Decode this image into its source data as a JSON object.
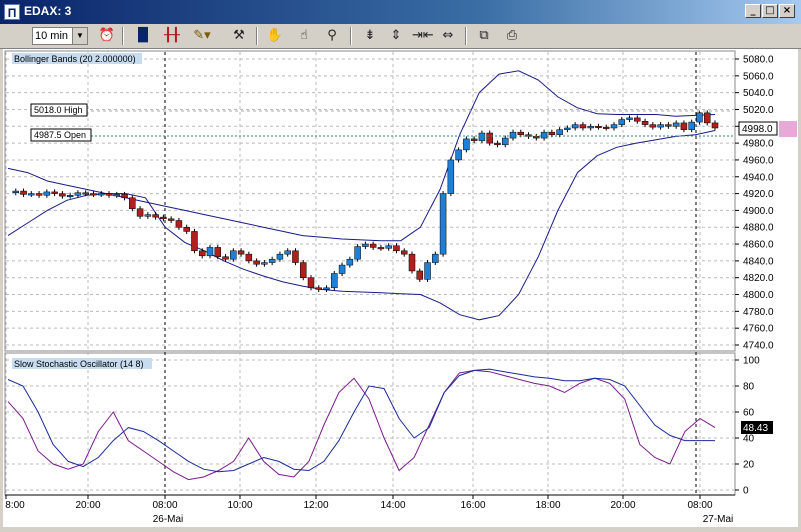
{
  "window": {
    "title": "EDAX: 3",
    "app_icon": "chart-app-icon",
    "controls": [
      "minimize-icon",
      "maximize-icon",
      "close-icon"
    ]
  },
  "toolbar": {
    "interval_value": "10 min",
    "icons": [
      "alarm-clock-icon",
      "bar-chart-icon",
      "candlestick-icon",
      "drawing-tool-icon",
      "tools-icon",
      "hand-pan-icon",
      "zoom-hand-icon",
      "magnifier-icon",
      "compress-vertical-icon",
      "expand-vertical-icon",
      "compress-horizontal-icon",
      "expand-horizontal-icon",
      "chart-window-icon",
      "printer-icon"
    ]
  },
  "price_panel": {
    "label": "Bollinger Bands (20 2.000000)",
    "high_label": "5018.0 High",
    "open_label": "4987.5 Open",
    "current_price": "4998.0",
    "y_ticks": [
      "5080.0",
      "5060.0",
      "5040.0",
      "5020.0",
      "5000.0",
      "4980.0",
      "4960.0",
      "4940.0",
      "4920.0",
      "4900.0",
      "4880.0",
      "4860.0",
      "4840.0",
      "4820.0",
      "4800.0",
      "4780.0",
      "4760.0",
      "4740.0"
    ]
  },
  "osc_panel": {
    "label": "Slow Stochastic Oscillator (14 8)",
    "current_value": "48.43",
    "y_ticks": [
      "100",
      "80",
      "60",
      "40",
      "20",
      "0"
    ]
  },
  "x_axis": {
    "time_labels": [
      "8:00",
      "20:00",
      "08:00",
      "10:00",
      "12:00",
      "14:00",
      "16:00",
      "18:00",
      "20:00",
      "08:00"
    ],
    "date_labels": [
      "26-Mai",
      "27-Mai"
    ]
  },
  "colors": {
    "up": "#1e7fd6",
    "down": "#b01e1e",
    "band": "#1a1a8c",
    "stoch_k": "#7a1a8c",
    "stoch_d": "#1a2a9c",
    "marker": "#e8a8d8"
  },
  "chart_data": [
    {
      "type": "candlestick",
      "title": "Bollinger Bands (20 2.000000)",
      "ylim": [
        4740,
        5085
      ],
      "x_labels": [
        "8:00",
        "20:00",
        "08:00",
        "10:00",
        "12:00",
        "14:00",
        "16:00",
        "18:00",
        "20:00",
        "08:00"
      ],
      "close_series": [
        4921,
        4923,
        4919,
        4920,
        4918,
        4922,
        4920,
        4917,
        4918,
        4921,
        4920,
        4919,
        4920,
        4918,
        4919,
        4915,
        4902,
        4893,
        4895,
        4892,
        4890,
        4888,
        4880,
        4875,
        4852,
        4846,
        4856,
        4845,
        4842,
        4852,
        4848,
        4840,
        4836,
        4838,
        4842,
        4848,
        4852,
        4838,
        4820,
        4808,
        4806,
        4808,
        4825,
        4835,
        4842,
        4857,
        4860,
        4856,
        4855,
        4858,
        4852,
        4848,
        4828,
        4818,
        4838,
        4848,
        4920,
        4960,
        4972,
        4985,
        4983,
        4992,
        4980,
        4978,
        4986,
        4993,
        4990,
        4988,
        4986,
        4993,
        4990,
        4996,
        4998,
        5002,
        4998,
        5000,
        4999,
        4998,
        5002,
        5008,
        5010,
        5006,
        5002,
        4999,
        5002,
        5000,
        5004,
        4996,
        5005,
        5016,
        5004,
        4998
      ],
      "bollinger_upper": [
        4950,
        4945,
        4935,
        4930,
        4925,
        4920,
        4915,
        4910,
        4905,
        4900,
        4895,
        4890,
        4885,
        4880,
        4875,
        4870,
        4868,
        4866,
        4865,
        4864,
        4864,
        4880,
        4925,
        4990,
        5040,
        5062,
        5066,
        5055,
        5035,
        5022,
        5015,
        5014,
        5014,
        5014,
        5012,
        5013,
        5014
      ],
      "bollinger_lower": [
        4870,
        4885,
        4900,
        4912,
        4918,
        4920,
        4920,
        4915,
        4880,
        4862,
        4852,
        4840,
        4830,
        4822,
        4815,
        4810,
        4806,
        4804,
        4803,
        4802,
        4801,
        4800,
        4790,
        4776,
        4770,
        4775,
        4800,
        4845,
        4900,
        4945,
        4965,
        4975,
        4980,
        4984,
        4988,
        4990,
        4995
      ],
      "current_price": 4998.0,
      "high": 5018.0,
      "open": 4987.5
    },
    {
      "type": "line",
      "title": "Slow Stochastic Oscillator (14 8)",
      "ylim": [
        0,
        100
      ],
      "series": [
        {
          "name": "",
          "values": [
            68,
            55,
            30,
            20,
            16,
            20,
            45,
            60,
            38,
            30,
            22,
            14,
            8,
            10,
            15,
            22,
            40,
            22,
            12,
            10,
            22,
            50,
            75,
            86,
            70,
            40,
            15,
            25,
            50,
            75,
            90,
            92,
            91,
            88,
            85,
            82,
            80,
            75,
            82,
            86,
            82,
            70,
            35,
            25,
            20,
            45,
            55,
            48
          ]
        },
        {
          "name": "",
          "values": [
            85,
            80,
            60,
            35,
            22,
            18,
            25,
            38,
            48,
            45,
            38,
            30,
            22,
            16,
            14,
            15,
            20,
            25,
            22,
            16,
            15,
            22,
            38,
            60,
            80,
            78,
            55,
            40,
            48,
            75,
            88,
            92,
            93,
            91,
            89,
            87,
            86,
            84,
            84,
            86,
            85,
            80,
            65,
            50,
            42,
            38,
            38,
            38
          ]
        }
      ],
      "current_value": 48.43
    }
  ]
}
